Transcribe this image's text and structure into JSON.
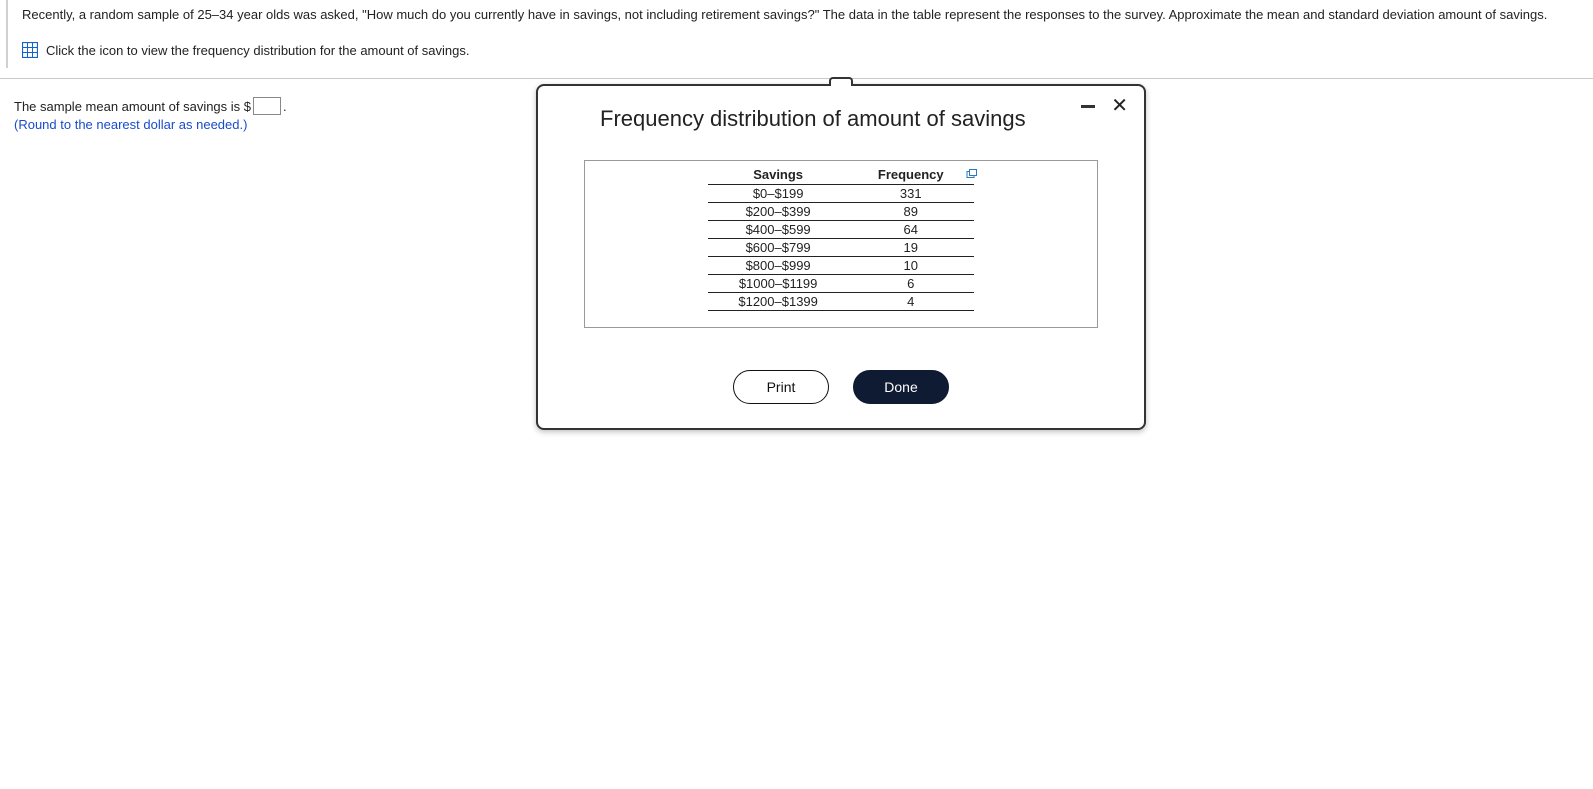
{
  "question": {
    "text": "Recently, a random sample of 25–34 year olds was asked, \"How much do you currently have in savings, not including retirement savings?\" The data in the table represent the responses to the survey. Approximate the mean and standard deviation amount of savings.",
    "icon_instruction": "Click the icon to view the frequency distribution for the amount of savings."
  },
  "answer": {
    "prefix": "The sample mean amount of savings is $",
    "suffix": ".",
    "input_value": "",
    "hint": "(Round to the nearest dollar as needed.)"
  },
  "dialog": {
    "title": "Frequency distribution of amount of savings",
    "headers": {
      "col1": "Savings",
      "col2": "Frequency"
    },
    "rows": [
      {
        "savings": "$0–$199",
        "frequency": "331"
      },
      {
        "savings": "$200–$399",
        "frequency": "89"
      },
      {
        "savings": "$400–$599",
        "frequency": "64"
      },
      {
        "savings": "$600–$799",
        "frequency": "19"
      },
      {
        "savings": "$800–$999",
        "frequency": "10"
      },
      {
        "savings": "$1000–$1199",
        "frequency": "6"
      },
      {
        "savings": "$1200–$1399",
        "frequency": "4"
      }
    ],
    "buttons": {
      "print": "Print",
      "done": "Done"
    }
  }
}
